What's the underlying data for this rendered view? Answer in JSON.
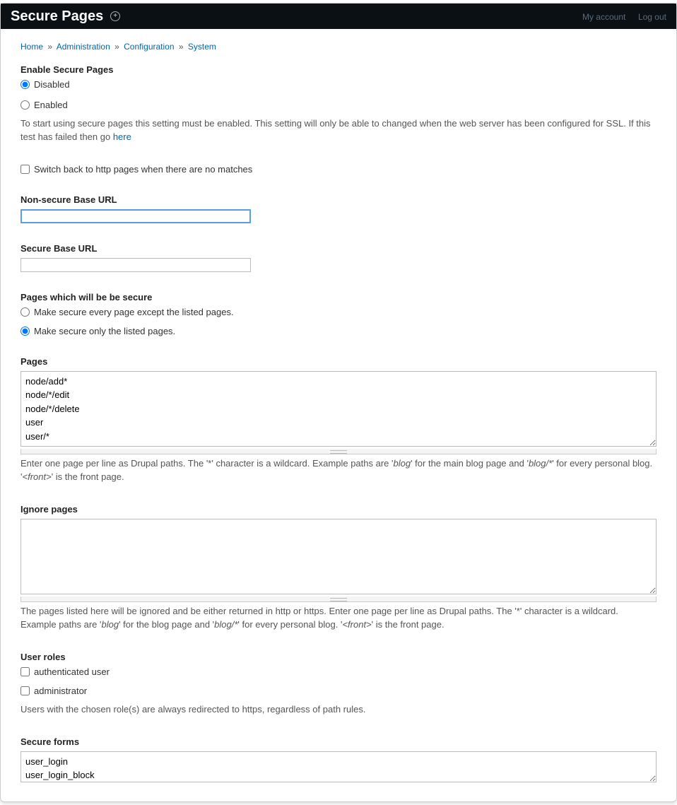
{
  "toolbar": {
    "title": "Secure Pages",
    "my_account": "My account",
    "log_out": "Log out"
  },
  "breadcrumb": {
    "home": "Home",
    "administration": "Administration",
    "configuration": "Configuration",
    "system": "System"
  },
  "enable": {
    "heading": "Enable Secure Pages",
    "disabled": "Disabled",
    "enabled": "Enabled",
    "desc_1": "To start using secure pages this setting must be enabled. This setting will only be able to changed when the web server has been configured for SSL. If this test has failed then go ",
    "here": "here"
  },
  "switch_back": {
    "label": "Switch back to http pages when there are no matches"
  },
  "nonsecure": {
    "label": "Non-secure Base URL",
    "value": ""
  },
  "secure": {
    "label": "Secure Base URL",
    "value": ""
  },
  "pages_mode": {
    "heading": "Pages which will be be secure",
    "except": "Make secure every page except the listed pages.",
    "only": "Make secure only the listed pages."
  },
  "pages": {
    "label": "Pages",
    "value": "node/add*\nnode/*/edit\nnode/*/delete\nuser\nuser/*",
    "desc_a": "Enter one page per line as Drupal paths. The '*' character is a wildcard. Example paths are '",
    "blog": "blog",
    "desc_b": "' for the main blog page and '",
    "blogstar": "blog/*",
    "desc_c": "' for every personal blog. '",
    "front": "<front>",
    "desc_d": "' is the front page."
  },
  "ignore": {
    "label": "Ignore pages",
    "value": "",
    "desc_a": "The pages listed here will be ignored and be either returned in http or https. Enter one page per line as Drupal paths. The '*' character is a wildcard. Example paths are '",
    "blog": "blog",
    "desc_b": "' for the blog page and '",
    "blogstar": "blog/*",
    "desc_c": "' for every personal blog. '",
    "front": "<front>",
    "desc_d": "' is the front page."
  },
  "roles": {
    "heading": "User roles",
    "authenticated": "authenticated user",
    "administrator": "administrator",
    "desc": "Users with the chosen role(s) are always redirected to https, regardless of path rules."
  },
  "forms": {
    "label": "Secure forms",
    "value": "user_login\nuser_login_block"
  }
}
